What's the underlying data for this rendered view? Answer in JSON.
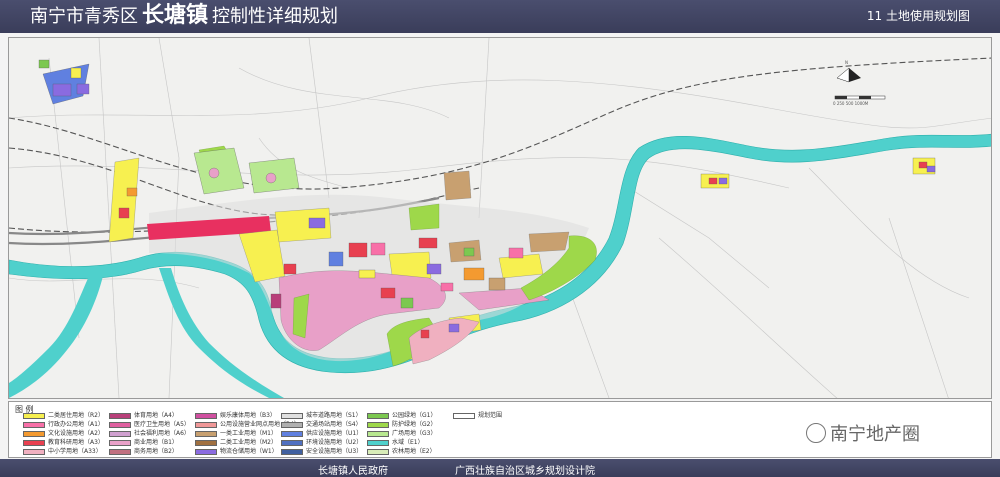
{
  "header": {
    "title_prefix": "南宁市青秀区",
    "title_town": "长塘镇",
    "title_suffix": "控制性详细规划",
    "sheet": "11  土地使用规划图"
  },
  "map": {
    "north_label": "N",
    "scale_label": "0   250   500   1000M",
    "colors": {
      "river": "#4fd0cc",
      "residential": "#f7f050",
      "commercial": "#e8a0c8",
      "industrial": "#c8a070",
      "admin": "#ff3a6a",
      "education": "#e84050",
      "green": "#9ed84a",
      "park": "#7cc850",
      "logistics": "#8a6be0",
      "utility": "#6080e0"
    }
  },
  "legend": {
    "title": "图    例",
    "items": [
      {
        "label": "二类居住用地（R2）",
        "color": "#f7f050"
      },
      {
        "label": "行政办公用地（A1）",
        "color": "#f870a8"
      },
      {
        "label": "文化设施用地（A2）",
        "color": "#f49a30"
      },
      {
        "label": "教育科研用地（A3）",
        "color": "#e84050"
      },
      {
        "label": "中小学用地（A33）",
        "color": "#f0b0c0"
      },
      {
        "label": "体育用地（A4）",
        "color": "#b8407a"
      },
      {
        "label": "医疗卫生用地（A5）",
        "color": "#e060a0"
      },
      {
        "label": "社会福利用地（A6）",
        "color": "#d0a0d0"
      },
      {
        "label": "商业用地（B1）",
        "color": "#e8a0c8"
      },
      {
        "label": "商务用地（B2）",
        "color": "#c07080"
      },
      {
        "label": "娱乐康体用地（B3）",
        "color": "#d050a0"
      },
      {
        "label": "公用设施营业网点用地（B4）",
        "color": "#f09898"
      },
      {
        "label": "一类工业用地（M1）",
        "color": "#c8a070"
      },
      {
        "label": "二类工业用地（M2）",
        "color": "#a07040"
      },
      {
        "label": "物流仓储用地（W1）",
        "color": "#8a6be0"
      },
      {
        "label": "城市道路用地（S1）",
        "color": "#e0e0e0"
      },
      {
        "label": "交通场站用地（S4）",
        "color": "#b0b0b0"
      },
      {
        "label": "供应设施用地（U1）",
        "color": "#6080e0"
      },
      {
        "label": "环境设施用地（U2）",
        "color": "#5070c0"
      },
      {
        "label": "安全设施用地（U3）",
        "color": "#4060a0"
      },
      {
        "label": "公园绿地（G1）",
        "color": "#7cc850"
      },
      {
        "label": "防护绿地（G2）",
        "color": "#9ed84a"
      },
      {
        "label": "广场用地（G3）",
        "color": "#b8e890"
      },
      {
        "label": "水域（E1）",
        "color": "#4fd0cc"
      },
      {
        "label": "农林用地（E2）",
        "color": "#d8ecb8"
      },
      {
        "label": "规划范围",
        "color": "#ffffff"
      }
    ]
  },
  "watermark": {
    "text": "南宁地产圈"
  },
  "footer": {
    "left": "长塘镇人民政府",
    "right": "广西壮族自治区城乡规划设计院"
  }
}
